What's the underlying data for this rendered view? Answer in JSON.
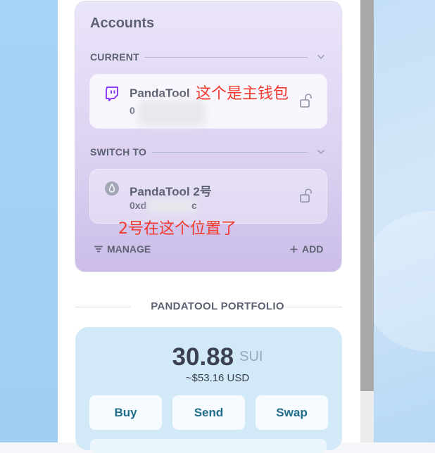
{
  "accounts": {
    "title": "Accounts",
    "current_label": "CURRENT",
    "switch_label": "SWITCH TO",
    "current_account": {
      "name": "PandaTool",
      "address": "0",
      "icon": "twitch-icon"
    },
    "other_account": {
      "name": "PandaTool 2号",
      "address": "0xd",
      "address_suffix": "c",
      "icon": "drop-icon"
    },
    "manage_label": "MANAGE",
    "add_label": "ADD"
  },
  "annotations": {
    "main_wallet": "这个是主钱包",
    "second_position": "2号在这个位置了"
  },
  "portfolio": {
    "label": "PANDATOOL PORTFOLIO",
    "balance": "30.88",
    "unit": "SUI",
    "usd": "~$53.16 USD",
    "actions": [
      "Buy",
      "Send",
      "Swap"
    ]
  },
  "colors": {
    "annotation": "#f03a2e",
    "twitch": "#8a3ff5",
    "accent": "#1f6e8a"
  }
}
